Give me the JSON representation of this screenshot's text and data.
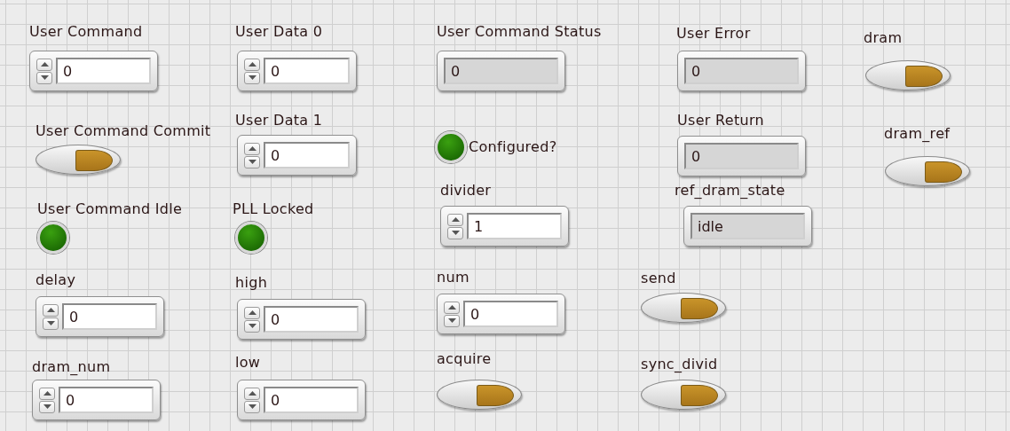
{
  "controls": [
    {
      "kind": "numeric",
      "label": "User Command",
      "value": "0"
    },
    {
      "kind": "numeric",
      "label": "User Data 0",
      "value": "0"
    },
    {
      "kind": "indicator",
      "label": "User Command Status",
      "value": "0"
    },
    {
      "kind": "indicator",
      "label": "User Error",
      "value": "0"
    },
    {
      "kind": "switch",
      "label": "dram",
      "on": false
    },
    {
      "kind": "switch",
      "label": "User Command Commit",
      "on": false
    },
    {
      "kind": "numeric",
      "label": "User Data 1",
      "value": "0"
    },
    {
      "kind": "led",
      "label": "Configured?",
      "on": true
    },
    {
      "kind": "indicator",
      "label": "User Return",
      "value": "0"
    },
    {
      "kind": "switch",
      "label": "dram_ref",
      "on": false
    },
    {
      "kind": "led",
      "label": "User Command Idle",
      "on": true
    },
    {
      "kind": "led",
      "label": "PLL Locked",
      "on": true
    },
    {
      "kind": "numeric",
      "label": "divider",
      "value": "1"
    },
    {
      "kind": "indicator",
      "label": "ref_dram_state",
      "value": "idle"
    },
    {
      "kind": "numeric",
      "label": "delay",
      "value": "0"
    },
    {
      "kind": "numeric",
      "label": "high",
      "value": "0"
    },
    {
      "kind": "numeric",
      "label": "num",
      "value": "0"
    },
    {
      "kind": "switch",
      "label": "send",
      "on": false
    },
    {
      "kind": "numeric",
      "label": "dram_num",
      "value": "0"
    },
    {
      "kind": "numeric",
      "label": "low",
      "value": "0"
    },
    {
      "kind": "switch",
      "label": "acquire",
      "on": false
    },
    {
      "kind": "switch",
      "label": "sync_divid",
      "on": false
    }
  ]
}
